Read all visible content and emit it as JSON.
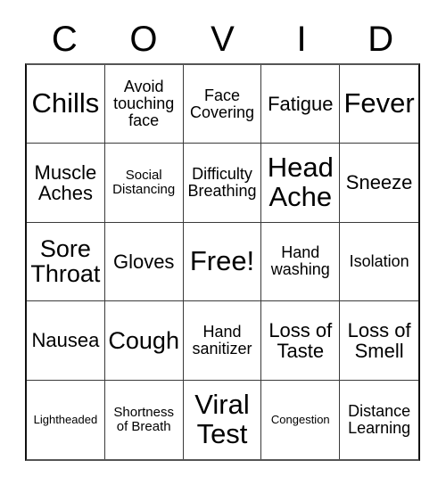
{
  "card": {
    "title_letters": [
      "C",
      "O",
      "V",
      "I",
      "D"
    ],
    "rows": [
      [
        {
          "label": "Chills",
          "size": "xl"
        },
        {
          "label": "Avoid touching face",
          "size": "sm"
        },
        {
          "label": "Face Covering",
          "size": "sm"
        },
        {
          "label": "Fatigue",
          "size": "md"
        },
        {
          "label": "Fever",
          "size": "xl"
        }
      ],
      [
        {
          "label": "Muscle Aches",
          "size": "md"
        },
        {
          "label": "Social Distancing",
          "size": "xs"
        },
        {
          "label": "Difficulty Breathing",
          "size": "sm"
        },
        {
          "label": "Head Ache",
          "size": "xl"
        },
        {
          "label": "Sneeze",
          "size": "md"
        }
      ],
      [
        {
          "label": "Sore Throat",
          "size": "lg"
        },
        {
          "label": "Gloves",
          "size": "md"
        },
        {
          "label": "Free!",
          "size": "xl"
        },
        {
          "label": "Hand washing",
          "size": "sm"
        },
        {
          "label": "Isolation",
          "size": "sm"
        }
      ],
      [
        {
          "label": "Nausea",
          "size": "md"
        },
        {
          "label": "Cough",
          "size": "lg"
        },
        {
          "label": "Hand sanitizer",
          "size": "sm"
        },
        {
          "label": "Loss of Taste",
          "size": "md"
        },
        {
          "label": "Loss of Smell",
          "size": "md"
        }
      ],
      [
        {
          "label": "Lightheaded",
          "size": "xxs"
        },
        {
          "label": "Shortness of Breath",
          "size": "xs"
        },
        {
          "label": "Viral Test",
          "size": "xl"
        },
        {
          "label": "Congestion",
          "size": "xxs"
        },
        {
          "label": "Distance Learning",
          "size": "sm"
        }
      ]
    ]
  }
}
